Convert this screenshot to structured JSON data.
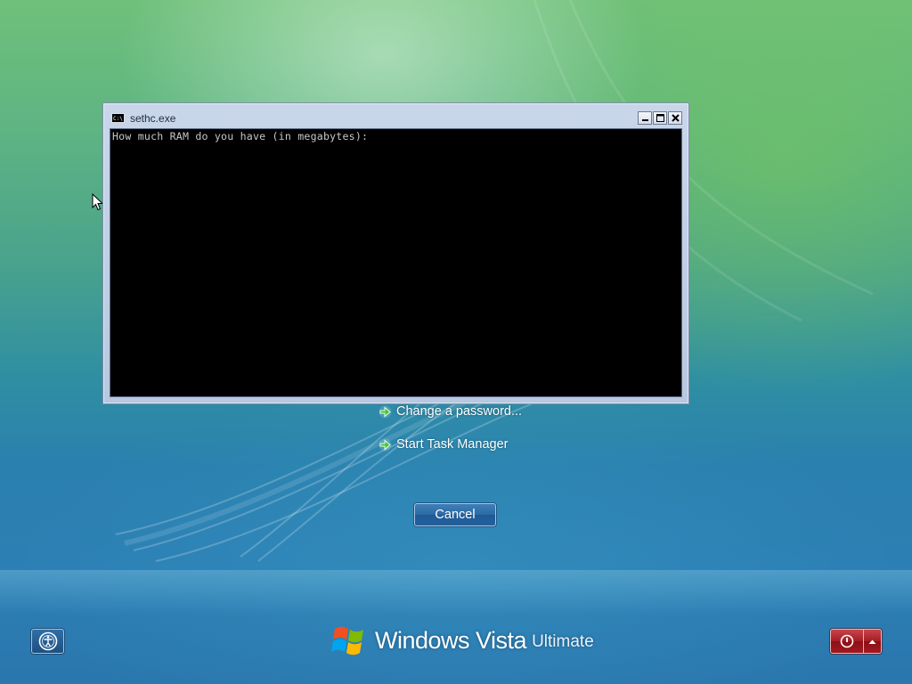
{
  "cmd_window": {
    "title": "sethc.exe",
    "icon": "console-icon",
    "console_text": "How much RAM do you have (in megabytes):",
    "controls": [
      "minimize",
      "maximize",
      "close"
    ]
  },
  "options": [
    {
      "label": "Change a password...",
      "icon": "green-arrow-icon"
    },
    {
      "label": "Start Task Manager",
      "icon": "green-arrow-icon"
    }
  ],
  "cancel_button": {
    "label": "Cancel"
  },
  "branding": {
    "windows": "Windows",
    "vista": "Vista",
    "edition": "Ultimate"
  },
  "colors": {
    "console_bg": "#000000",
    "console_text": "#c6c6c6",
    "power_red": "#a51c24",
    "arrow_green": "#3fbf3a"
  }
}
